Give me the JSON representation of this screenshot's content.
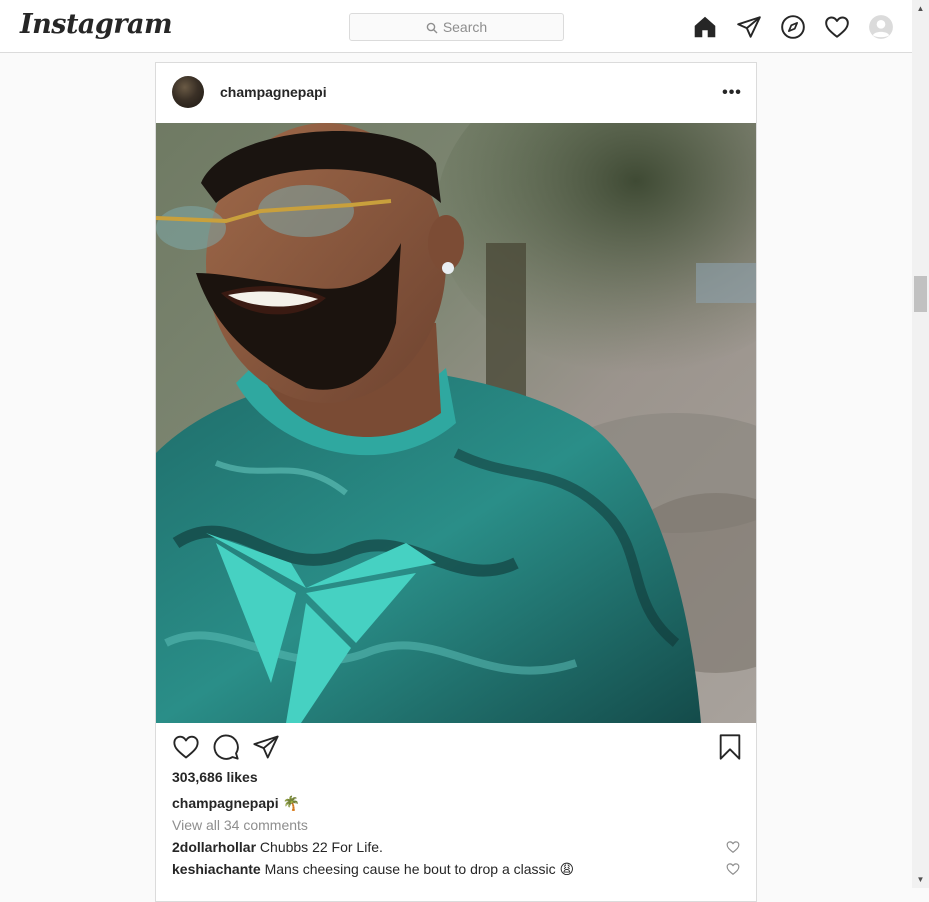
{
  "header": {
    "logo": "Instagram",
    "search_placeholder": "Search",
    "icons": [
      "home-icon",
      "direct-icon",
      "explore-icon",
      "activity-icon",
      "profile-avatar"
    ]
  },
  "post": {
    "username": "champagnepapi",
    "more_label": "•••",
    "likes": "303,686 likes",
    "caption_user": "champagnepapi",
    "caption_text": "🌴",
    "view_all": "View all 34 comments",
    "comments": [
      {
        "user": "2dollarhollar",
        "text": "Chubbs 22 For Life."
      },
      {
        "user": "keshiachante",
        "text": "Mans cheesing cause he bout to drop a classic 😩"
      }
    ]
  },
  "colors": {
    "accent_text": "#262626",
    "muted_text": "#8e8e8e",
    "border": "#dbdbdb",
    "shirt_teal": "#2fa8a0"
  }
}
